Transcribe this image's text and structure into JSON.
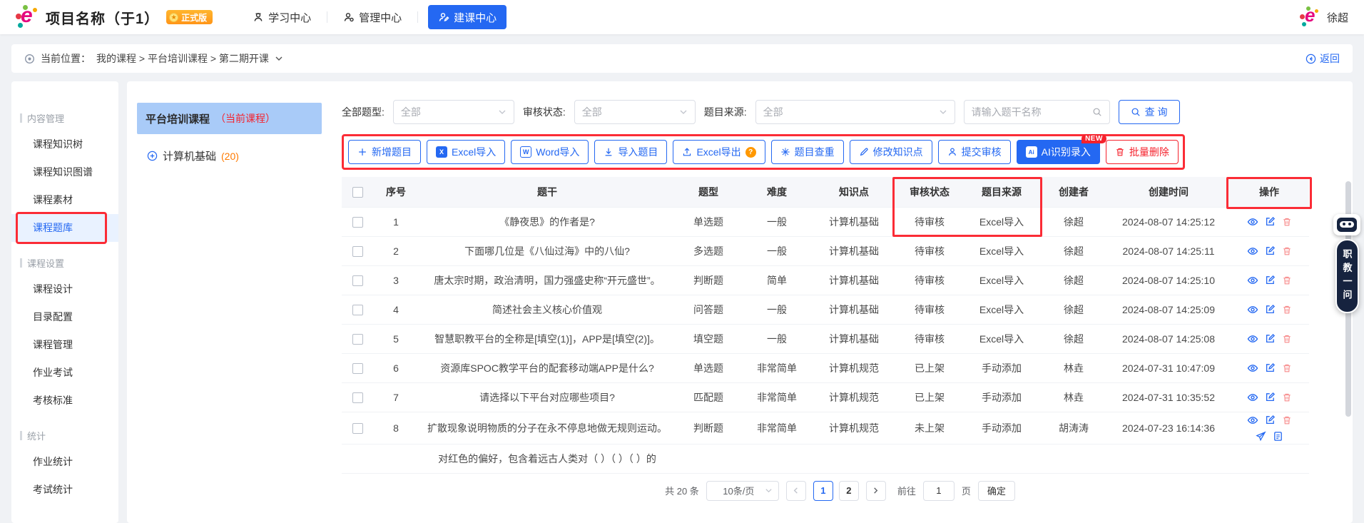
{
  "colors": {
    "accent_blue": "#2468f2",
    "annotation_red": "#fb2c36",
    "badge_orange": "#ff9518",
    "tree_selected_blue": "#a9cbf8",
    "tag_red": "#f5222d",
    "count_orange": "#ff7a00",
    "delete_pink": "#f78989"
  },
  "header": {
    "title": "项目名称（于1）",
    "version_badge": "正式版",
    "nav": [
      {
        "label": "学习中心",
        "icon": "learn-center-icon",
        "active": false
      },
      {
        "label": "管理中心",
        "icon": "admin-center-icon",
        "active": false
      },
      {
        "label": "建课中心",
        "icon": "build-course-icon",
        "active": true
      }
    ],
    "user_name": "徐超"
  },
  "breadcrumb": {
    "prefix": "当前位置：",
    "path": "我的课程 > 平台培训课程 > 第二期开课",
    "back_label": "返回"
  },
  "sidebar": {
    "sections": [
      {
        "title": "内容管理",
        "items": [
          {
            "label": "课程知识树",
            "active": false
          },
          {
            "label": "课程知识图谱",
            "active": false
          },
          {
            "label": "课程素材",
            "active": false
          },
          {
            "label": "课程题库",
            "active": true
          }
        ]
      },
      {
        "title": "课程设置",
        "items": [
          {
            "label": "课程设计",
            "active": false
          },
          {
            "label": "目录配置",
            "active": false
          },
          {
            "label": "课程管理",
            "active": false
          },
          {
            "label": "作业考试",
            "active": false
          },
          {
            "label": "考核标准",
            "active": false
          }
        ]
      },
      {
        "title": "统计",
        "items": [
          {
            "label": "作业统计",
            "active": false
          },
          {
            "label": "考试统计",
            "active": false
          }
        ]
      }
    ]
  },
  "course_tree": {
    "current_name": "平台培训课程",
    "current_tag": "（当前课程）",
    "node_name": "计算机基础",
    "node_count": "(20)"
  },
  "filters": {
    "type_label": "全部题型:",
    "type_value": "全部",
    "status_label": "审核状态:",
    "status_value": "全部",
    "source_label": "题目来源:",
    "source_value": "全部",
    "search_placeholder": "请输入题干名称",
    "query_label": "查 询"
  },
  "toolbar": {
    "buttons": [
      {
        "label": "新增题目",
        "icon": "plus-icon",
        "variant": "outline"
      },
      {
        "label": "Excel导入",
        "icon": "excel-import-icon",
        "variant": "outline"
      },
      {
        "label": "Word导入",
        "icon": "word-import-icon",
        "variant": "outline"
      },
      {
        "label": "导入题目",
        "icon": "download-icon",
        "variant": "outline"
      },
      {
        "label": "Excel导出",
        "icon": "upload-icon",
        "variant": "outline",
        "suffix_icon": "help-icon"
      },
      {
        "label": "题目查重",
        "icon": "duplicate-check-icon",
        "variant": "outline"
      },
      {
        "label": "修改知识点",
        "icon": "pencil-icon",
        "variant": "outline"
      },
      {
        "label": "提交审核",
        "icon": "submit-review-icon",
        "variant": "outline"
      },
      {
        "label": "AI识别录入",
        "icon": "ai-icon",
        "variant": "solid",
        "badge": "NEW"
      },
      {
        "label": "批量删除",
        "icon": "trash-icon",
        "variant": "danger"
      }
    ]
  },
  "table": {
    "headers": [
      "序号",
      "题干",
      "题型",
      "难度",
      "知识点",
      "审核状态",
      "题目来源",
      "创建者",
      "创建时间",
      "操作"
    ],
    "rows": [
      {
        "no": "1",
        "stem": "《静夜思》的作者是?",
        "type": "单选题",
        "difficulty": "一般",
        "knowledge": "计算机基础",
        "status": "待审核",
        "source": "Excel导入",
        "creator": "徐超",
        "created": "2024-08-07 14:25:12",
        "actions": [
          "view",
          "edit",
          "delete"
        ],
        "partial": false
      },
      {
        "no": "2",
        "stem": "下面哪几位是《八仙过海》中的八仙?",
        "type": "多选题",
        "difficulty": "一般",
        "knowledge": "计算机基础",
        "status": "待审核",
        "source": "Excel导入",
        "creator": "徐超",
        "created": "2024-08-07 14:25:11",
        "actions": [
          "view",
          "edit",
          "delete"
        ],
        "partial": false
      },
      {
        "no": "3",
        "stem": "唐太宗时期，政治清明，国力强盛史称“开元盛世”。",
        "type": "判断题",
        "difficulty": "简单",
        "knowledge": "计算机基础",
        "status": "待审核",
        "source": "Excel导入",
        "creator": "徐超",
        "created": "2024-08-07 14:25:10",
        "actions": [
          "view",
          "edit",
          "delete"
        ],
        "partial": false
      },
      {
        "no": "4",
        "stem": "简述社会主义核心价值观",
        "type": "问答题",
        "difficulty": "一般",
        "knowledge": "计算机基础",
        "status": "待审核",
        "source": "Excel导入",
        "creator": "徐超",
        "created": "2024-08-07 14:25:09",
        "actions": [
          "view",
          "edit",
          "delete"
        ],
        "partial": false
      },
      {
        "no": "5",
        "stem": "智慧职教平台的全称是[填空(1)]，APP是[填空(2)]。",
        "type": "填空题",
        "difficulty": "一般",
        "knowledge": "计算机基础",
        "status": "待审核",
        "source": "Excel导入",
        "creator": "徐超",
        "created": "2024-08-07 14:25:08",
        "actions": [
          "view",
          "edit",
          "delete"
        ],
        "partial": false
      },
      {
        "no": "6",
        "stem": "资源库SPOC教学平台的配套移动端APP是什么?",
        "type": "单选题",
        "difficulty": "非常简单",
        "knowledge": "计算机规范",
        "status": "已上架",
        "source": "手动添加",
        "creator": "林垚",
        "created": "2024-07-31 10:47:09",
        "actions": [
          "view",
          "edit",
          "delete"
        ],
        "partial": false
      },
      {
        "no": "7",
        "stem": "请选择以下平台对应哪些项目?",
        "type": "匹配题",
        "difficulty": "非常简单",
        "knowledge": "计算机规范",
        "status": "已上架",
        "source": "手动添加",
        "creator": "林垚",
        "created": "2024-07-31 10:35:52",
        "actions": [
          "view",
          "edit",
          "delete"
        ],
        "partial": false
      },
      {
        "no": "8",
        "stem": "扩散现象说明物质的分子在永不停息地做无规则运动。",
        "type": "判断题",
        "difficulty": "非常简单",
        "knowledge": "计算机规范",
        "status": "未上架",
        "source": "手动添加",
        "creator": "胡涛涛",
        "created": "2024-07-23 16:14:36",
        "actions": [
          "view",
          "edit",
          "delete",
          "send",
          "export"
        ],
        "partial": false
      },
      {
        "no": "",
        "stem": "对红色的偏好，包含着远古人类对（ ）（ ）（ ）的",
        "type": "",
        "difficulty": "",
        "knowledge": "",
        "status": "",
        "source": "",
        "creator": "",
        "created": "",
        "actions": [],
        "partial": true
      }
    ]
  },
  "pagination": {
    "total": "共 20 条",
    "page_size": "10条/页",
    "pages": [
      "1",
      "2"
    ],
    "current": "1",
    "goto_label": "前往",
    "goto_value": "1",
    "page_unit": "页",
    "confirm_label": "确定"
  },
  "floating_widget": {
    "label": "职教一问"
  }
}
